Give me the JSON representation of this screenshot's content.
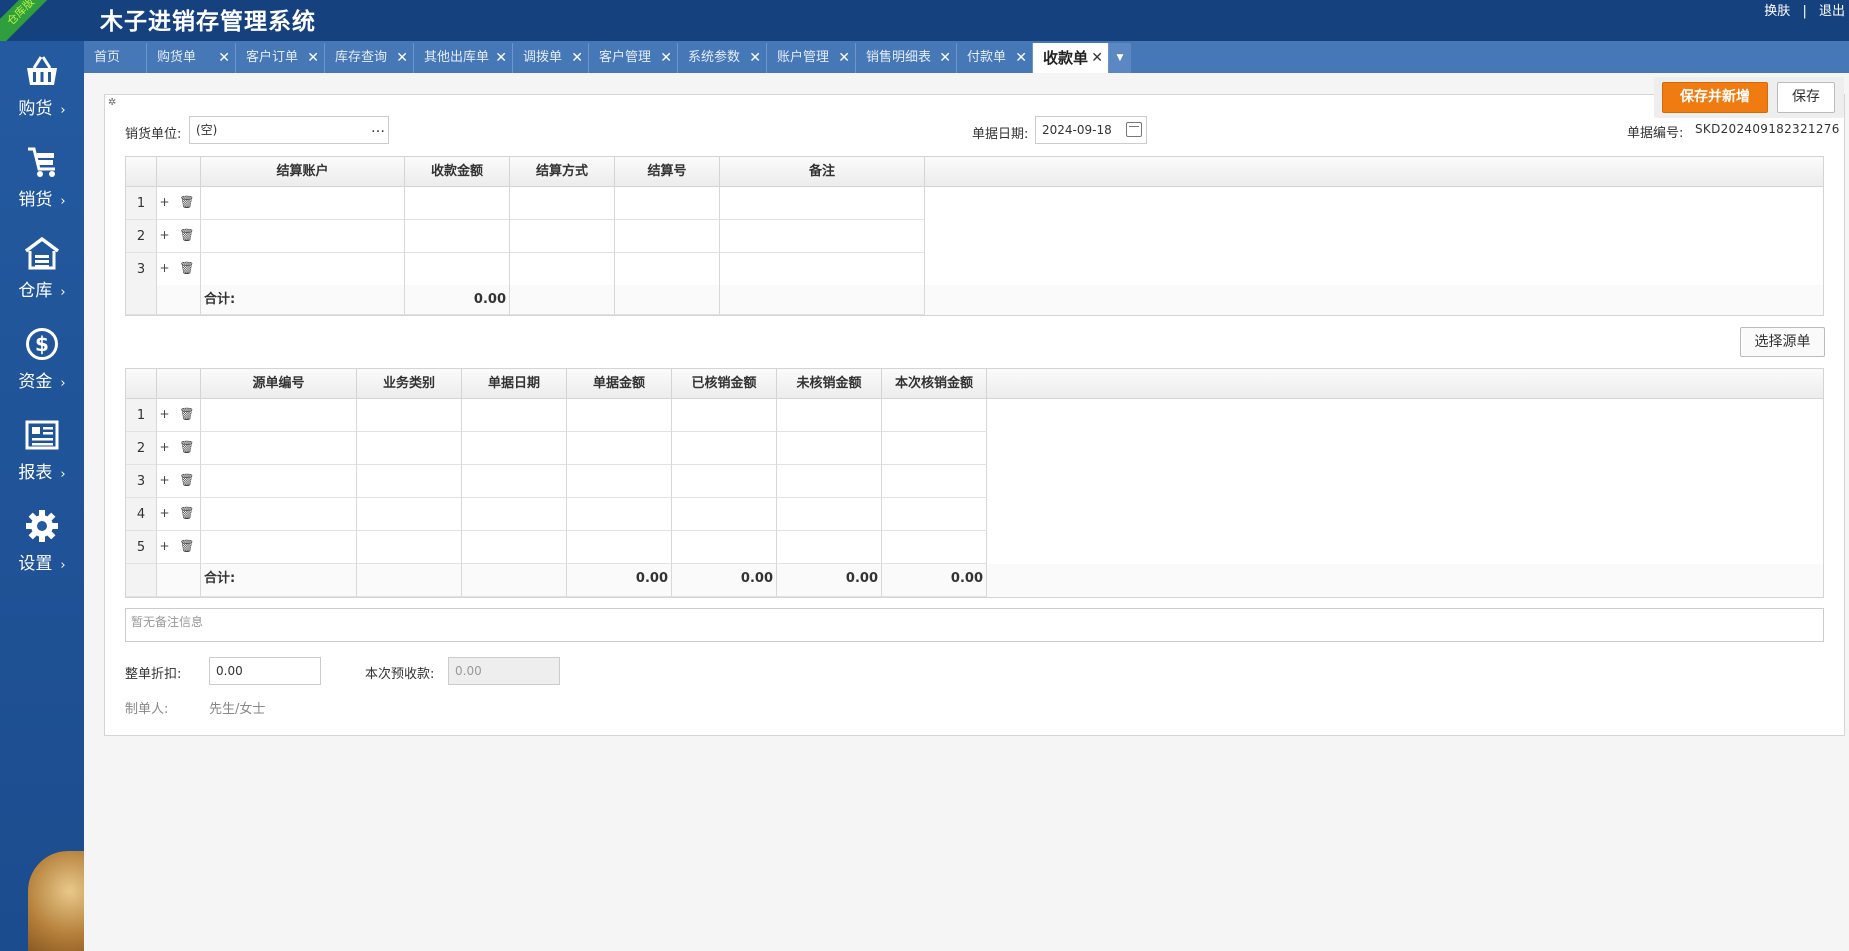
{
  "header": {
    "title": "木子进销存管理系统",
    "ribbon": "仓库版",
    "links": [
      "换肤",
      "|",
      "退出"
    ]
  },
  "sidebar": {
    "items": [
      {
        "label": "购货",
        "icon": "basket-icon"
      },
      {
        "label": "销货",
        "icon": "cart-icon"
      },
      {
        "label": "仓库",
        "icon": "warehouse-icon"
      },
      {
        "label": "资金",
        "icon": "dollar-icon"
      },
      {
        "label": "报表",
        "icon": "report-icon"
      },
      {
        "label": "设置",
        "icon": "gear-icon"
      }
    ],
    "arrow": "›"
  },
  "tabs": [
    {
      "label": "首页"
    },
    {
      "label": "购货单"
    },
    {
      "label": "客户订单"
    },
    {
      "label": "库存查询"
    },
    {
      "label": "其他出库单"
    },
    {
      "label": "调拨单"
    },
    {
      "label": "客户管理"
    },
    {
      "label": "系统参数"
    },
    {
      "label": "账户管理"
    },
    {
      "label": "销售明细表"
    },
    {
      "label": "付款单"
    },
    {
      "label": "收款单"
    }
  ],
  "tab_close": "✕",
  "toolbar": {
    "save_new_label": "保存并新增",
    "save_label": "保存"
  },
  "form": {
    "customer_label": "销货单位:",
    "customer_value": "(空)",
    "date_label": "单据日期:",
    "date_value": "2024-09-18",
    "number_label": "单据编号:",
    "number_value": "SKD202409182321276"
  },
  "grid1": {
    "headers": [
      "结算账户",
      "收款金额",
      "结算方式",
      "结算号",
      "备注"
    ],
    "rows": [
      "1",
      "2",
      "3"
    ],
    "ops": "+ 🗑",
    "total_label": "合计:",
    "total_amount": "0.00"
  },
  "select_source_label": "选择源单",
  "grid2": {
    "headers": [
      "源单编号",
      "业务类别",
      "单据日期",
      "单据金额",
      "已核销金额",
      "未核销金额",
      "本次核销金额"
    ],
    "rows": [
      "1",
      "2",
      "3",
      "4",
      "5"
    ],
    "ops": "+ 🗑",
    "total_label": "合计:",
    "totals": [
      "0.00",
      "0.00",
      "0.00",
      "0.00"
    ]
  },
  "remark_placeholder": "暂无备注信息",
  "bottom": {
    "discount_label": "整单折扣:",
    "discount_value": "0.00",
    "prepay_label": "本次预收款:",
    "prepay_value": "0.00",
    "maker_label": "制单人:",
    "maker_value": "先生/女士"
  }
}
